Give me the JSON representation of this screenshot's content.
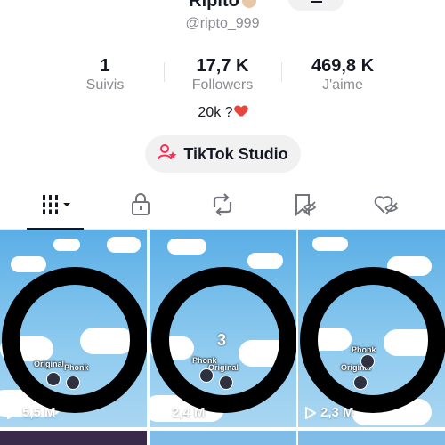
{
  "profile": {
    "name": "Ripito",
    "handle": "@ripto_999",
    "bio": "20k ?"
  },
  "stats": [
    {
      "value": "1",
      "label": "Suivis"
    },
    {
      "value": "17,7 K",
      "label": "Followers"
    },
    {
      "value": "469,8 K",
      "label": "J'aime"
    }
  ],
  "studio_button": {
    "label": "TikTok Studio",
    "icon": "person-star-icon",
    "icon_color": "#fe2c55"
  },
  "tabs": [
    {
      "name": "videos",
      "icon": "grid-icon",
      "active": true
    },
    {
      "name": "private",
      "icon": "lock-icon"
    },
    {
      "name": "reposts",
      "icon": "repost-icon"
    },
    {
      "name": "favorites",
      "icon": "bookmark-hidden-icon"
    },
    {
      "name": "liked",
      "icon": "heart-hidden-icon"
    }
  ],
  "videos": [
    {
      "views": "5,5 M",
      "overlay": [
        "Original",
        "Phonk"
      ]
    },
    {
      "views": "2,4 M",
      "overlay": [
        "3",
        "Phonk",
        "Original"
      ]
    },
    {
      "views": "2,3 M",
      "overlay": [
        "Phonk",
        "Original"
      ]
    }
  ],
  "colors": {
    "accent": "#fe2c55",
    "heart": "#e8453c",
    "sky": "#5aaee6"
  }
}
